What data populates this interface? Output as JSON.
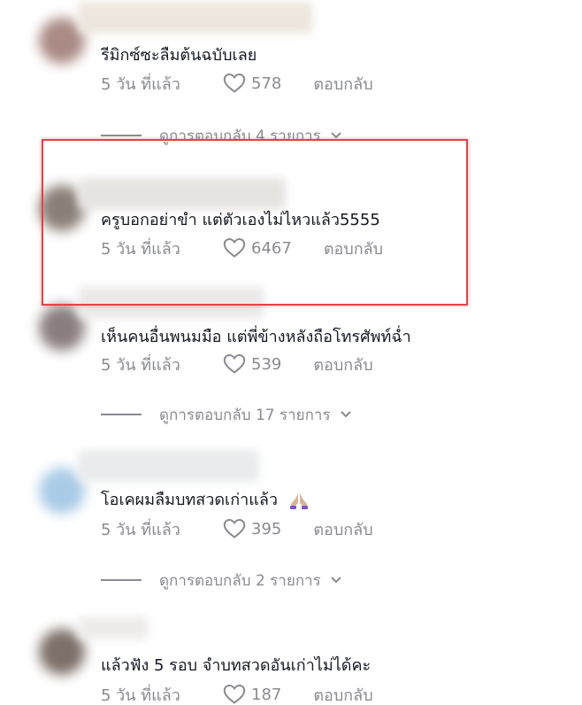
{
  "comments": [
    {
      "text": "รีมิกซ์ซะลืมต้นฉบับเลย",
      "time": "5 วัน ที่แล้ว",
      "likes": "578",
      "reply": "ตอบกลับ",
      "view_replies": "ดูการตอบกลับ 4 รายการ"
    },
    {
      "text": "ครูบอกอย่าขำ แต่ตัวเองไม่ไหวแล้ว5555",
      "time": "5 วัน ที่แล้ว",
      "likes": "6467",
      "reply": "ตอบกลับ"
    },
    {
      "text": "เห็นคนอื่นพนมมือ แต่พี่ข้างหลังถือโทรศัพท์ฉ่ำ",
      "time": "5 วัน ที่แล้ว",
      "likes": "539",
      "reply": "ตอบกลับ",
      "view_replies": "ดูการตอบกลับ 17 รายการ"
    },
    {
      "text": "โอเคผมลืมบทสวดเก่าแล้ว",
      "time": "5 วัน ที่แล้ว",
      "likes": "395",
      "reply": "ตอบกลับ",
      "view_replies": "ดูการตอบกลับ 2 รายการ"
    },
    {
      "text": "แล้วฟัง 5 รอบ จำบทสวดอันเก่าไม่ได้คะ",
      "time": "5 วัน ที่แล้ว",
      "likes": "187",
      "reply": "ตอบกลับ"
    }
  ],
  "icons": {
    "like": "heart-outline-icon",
    "expand": "chevron-down-icon",
    "emoji": "folded-hands-emoji"
  },
  "colors": {
    "text": "#161823",
    "muted": "#8a8b91",
    "highlight": "#e0454a"
  }
}
